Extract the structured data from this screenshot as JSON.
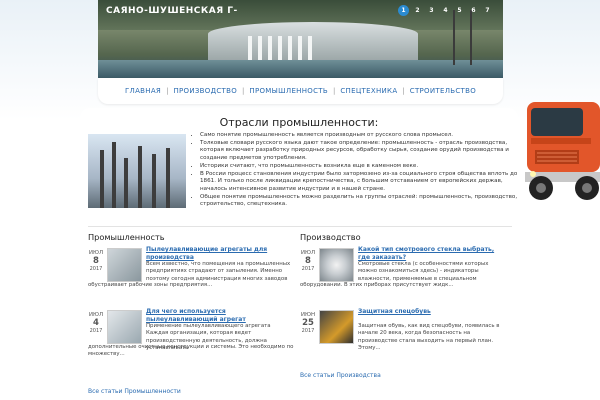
{
  "header": {
    "site_title": "САЯНО-ШУШЕНСКАЯ Г-",
    "slides": [
      "1",
      "2",
      "3",
      "4",
      "5",
      "6",
      "7"
    ],
    "active_slide": 0
  },
  "nav": {
    "items": [
      "ГЛАВНАЯ",
      "ПРОИЗВОДСТВО",
      "ПРОМЫШЛЕННОСТЬ",
      "СПЕЦТЕХНИКА",
      "СТРОИТЕЛЬСТВО"
    ]
  },
  "main": {
    "title": "Отрасли промышленности:",
    "intro": [
      "Само понятие промышленность является производным от русского слова промысел.",
      "Толковые словари русского языка дают такое определение: промышленность - отрасль производства, которая включает разработку природных ресурсов, обработку сырья, создание орудий производства и создание предметов употребления.",
      "Историки считают, что промышленность возникла еще в каменном веке.",
      "В России процесс становления индустрии было затормозено из-за социального строя общества вплоть до 1861. И только после ликвидации крепостничества, с большим отставанием от европейских держав, началось интенсивное развитие индустрии и в нашей стране.",
      "Общее понятие промышленность можно разделить на группы отраслей: промышленность, производство, строительство, спецтехника."
    ]
  },
  "columns": [
    {
      "title": "Промышленность",
      "posts": [
        {
          "month": "ИЮЛ",
          "day": "8",
          "year": "2017",
          "title": "Пылеулавливающие агрегаты для производства",
          "text": "Всем известно, что помещения на промышленных предприятиях страдают от запыления. Именно поэтому сегодня администрация многих заводов",
          "text_full": "обустраивает рабочие зоны предприятия..."
        },
        {
          "month": "ИЮЛ",
          "day": "4",
          "year": "2017",
          "title": "Для чего используется пылеулавливающий агрегат",
          "text": "Применение пылеулавливающего агрегата Каждая организация, которая ведет производственную деятельность, должна устанавливать",
          "text_full": "дополнительные очистные конструкции и системы. Это необходимо по множеству..."
        }
      ],
      "all_link": "Все статьи Промышленности"
    },
    {
      "title": "Производство",
      "posts": [
        {
          "month": "ИЮЛ",
          "day": "8",
          "year": "2017",
          "title": "Какой тип смотрового стекла выбрать, где заказать?",
          "text": "Смотровые стекла (с особенностями которых можно ознакомиться здесь) - индикаторы влажности, применяемые в специальном",
          "text_full": "оборудовании. В этих приборах присутствует жидк..."
        },
        {
          "month": "ИЮН",
          "day": "25",
          "year": "2017",
          "title": "Защитная спецобувь",
          "text": "Защитная обувь, как вид спецобуви, появилась в начале 20 века, когда безопасность на производстве стала выходить на первый план. Этому...",
          "text_full": ""
        }
      ],
      "all_link": "Все статьи Производства"
    }
  ]
}
